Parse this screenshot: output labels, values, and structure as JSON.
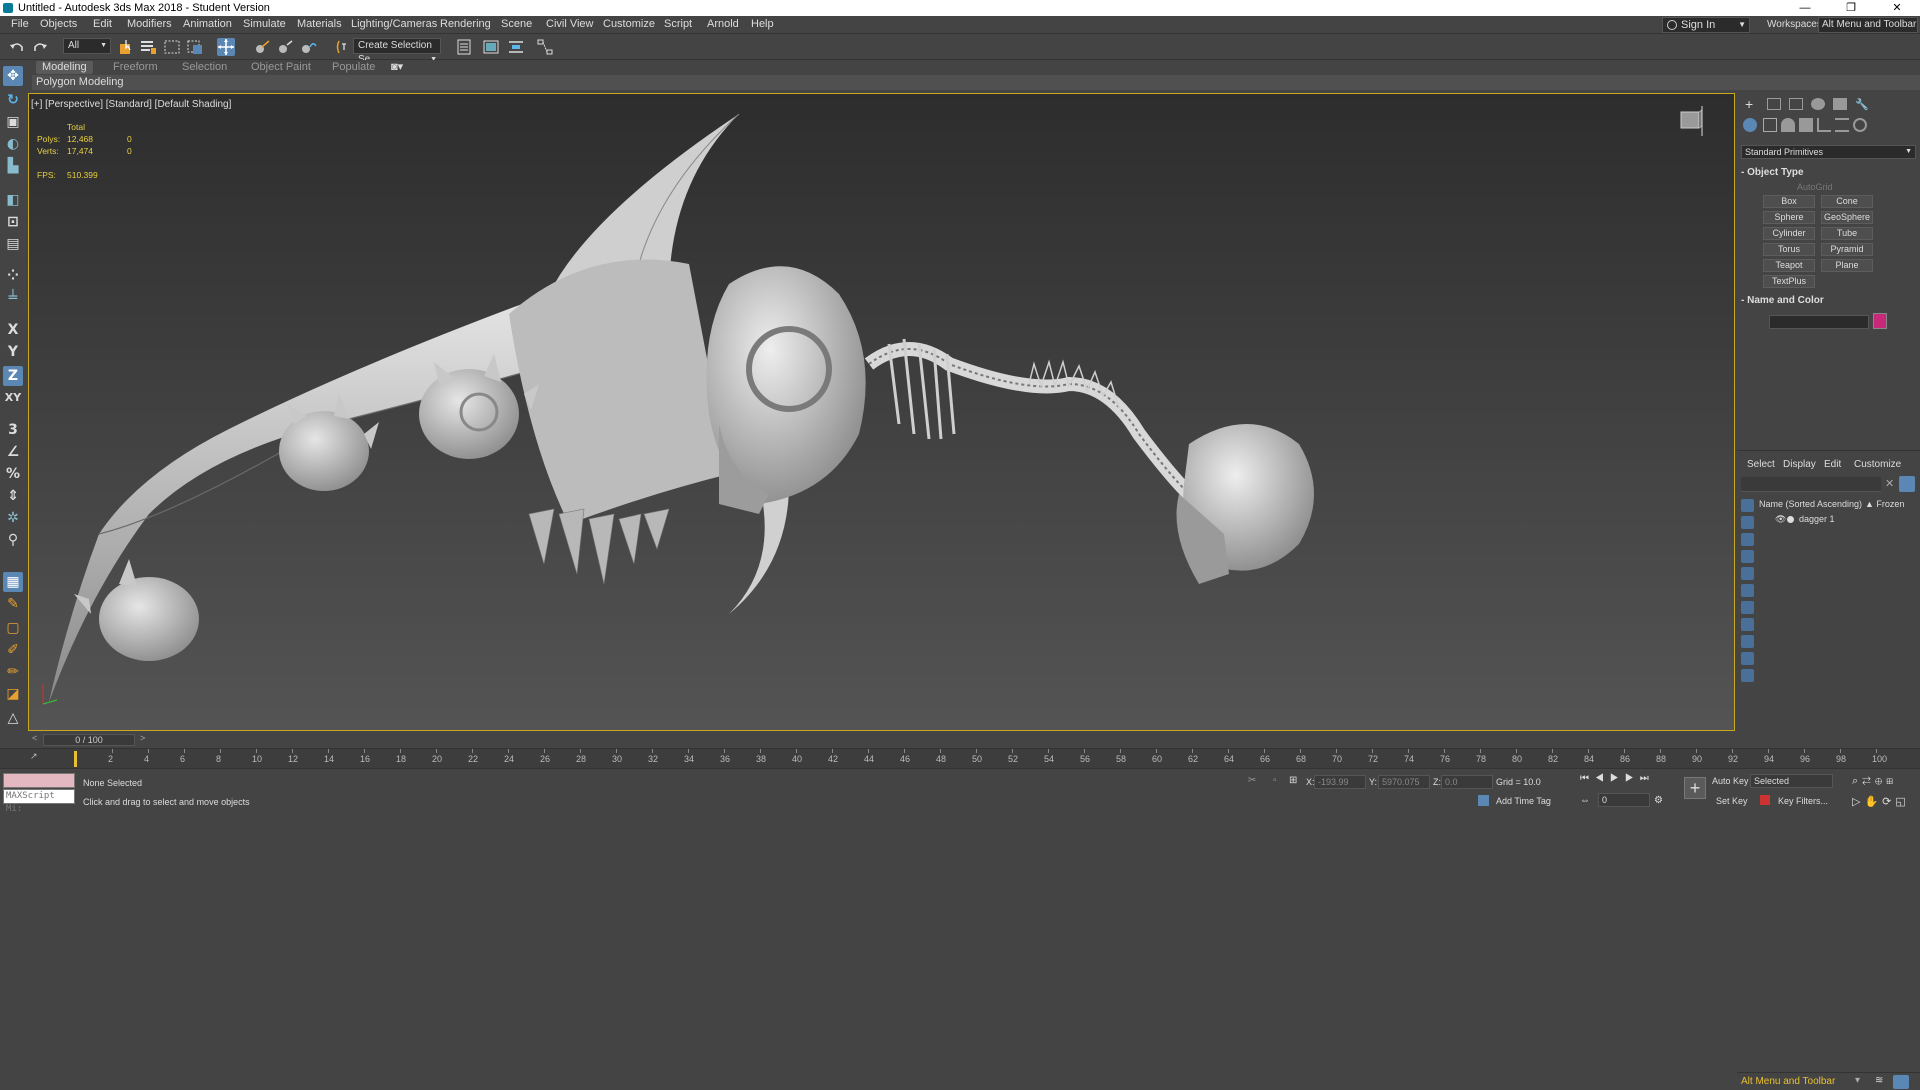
{
  "window": {
    "title": "Untitled - Autodesk 3ds Max 2018 - Student Version",
    "controls": [
      "—",
      "❐",
      "✕"
    ]
  },
  "menu": {
    "items": [
      "File",
      "Objects",
      "Edit",
      "Modifiers",
      "Animation",
      "Simulate",
      "Materials",
      "Lighting/Cameras",
      "Rendering",
      "Scene",
      "Civil View",
      "Customize",
      "Script",
      "Arnold",
      "Help"
    ],
    "sign_in": "Sign In",
    "workspaces_label": "Workspaces:",
    "workspaces_value": "Alt Menu and Toolbar"
  },
  "toolbar": {
    "filter_value": "All",
    "selection_set_placeholder": "Create Selection Se"
  },
  "ribbon": {
    "tabs": [
      "Modeling",
      "Freeform",
      "Selection",
      "Object Paint",
      "Populate"
    ],
    "active_tab": "Modeling",
    "panel": "Polygon Modeling"
  },
  "left_toolbar": {
    "labels": [
      "X",
      "Y",
      "Z",
      "XY"
    ]
  },
  "viewport": {
    "label": "[+] [Perspective] [Standard] [Default Shading]",
    "stats": {
      "total_label": "Total",
      "polys_label": "Polys:",
      "polys_total": "12,468",
      "polys_sel": "0",
      "verts_label": "Verts:",
      "verts_total": "17,474",
      "verts_sel": "0",
      "fps_label": "FPS:",
      "fps": "510.399"
    }
  },
  "command_panel": {
    "category": "Standard Primitives",
    "object_type_title": "Object Type",
    "autogrid": "AutoGrid",
    "primitives": [
      "Box",
      "Cone",
      "Sphere",
      "GeoSphere",
      "Cylinder",
      "Tube",
      "Torus",
      "Pyramid",
      "Teapot",
      "Plane",
      "TextPlus"
    ],
    "name_color_title": "Name and Color",
    "object_color": "#c8287a"
  },
  "scene_explorer": {
    "tabs": [
      "Select",
      "Display",
      "Edit",
      "Customize"
    ],
    "column_name": "Name (Sorted Ascending)",
    "column_frozen": "▲ Frozen",
    "objects": [
      "dagger 1"
    ],
    "workspace_label": "Alt Menu and Toolbar"
  },
  "time": {
    "slider": "0 / 100",
    "ticks": [
      "0",
      "2",
      "4",
      "6",
      "8",
      "10",
      "12",
      "14",
      "16",
      "18",
      "20",
      "22",
      "24",
      "26",
      "28",
      "30",
      "32",
      "34",
      "36",
      "38",
      "40",
      "42",
      "44",
      "46",
      "48",
      "50",
      "52",
      "54",
      "56",
      "58",
      "60",
      "62",
      "64",
      "66",
      "68",
      "70",
      "72",
      "74",
      "76",
      "78",
      "80",
      "82",
      "84",
      "86",
      "88",
      "90",
      "92",
      "94",
      "96",
      "98",
      "100"
    ]
  },
  "status": {
    "maxscript_placeholder": "MAXScript Mi:",
    "selection": "None Selected",
    "prompt": "Click and drag to select and move objects",
    "x_label": "X:",
    "x_value": "-193.99",
    "y_label": "Y:",
    "y_value": "5970.075",
    "z_label": "Z:",
    "z_value": "0.0",
    "grid": "Grid = 10.0",
    "add_time_tag": "Add Time Tag",
    "frame": "0",
    "auto_key": "Auto Key",
    "set_key": "Set Key",
    "selected_dropdown": "Selected",
    "key_filters": "Key Filters..."
  }
}
